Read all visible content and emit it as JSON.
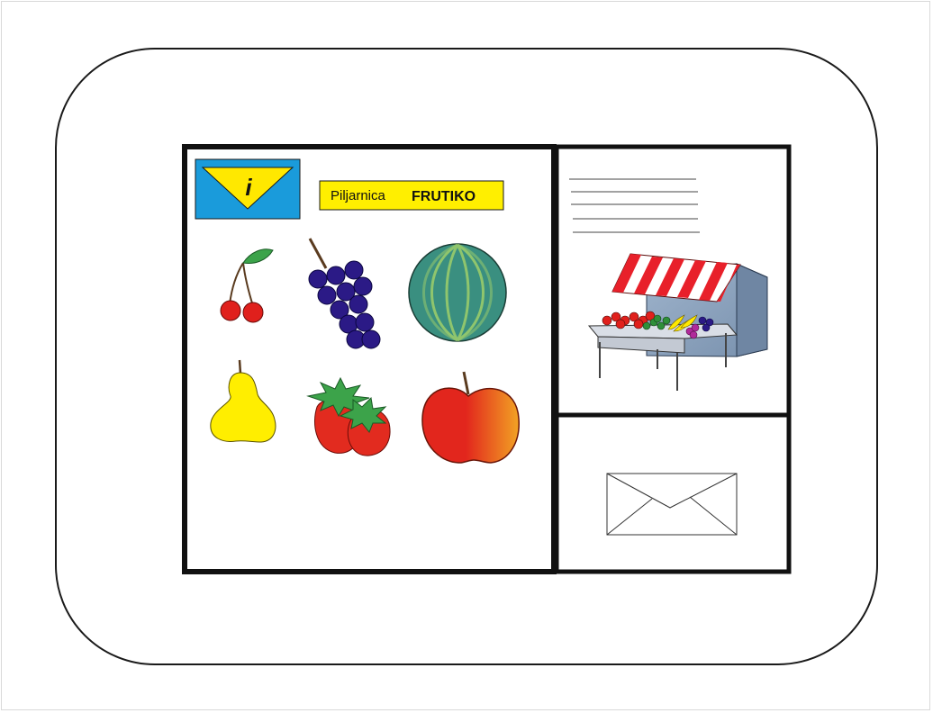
{
  "sign": {
    "info_symbol": "i",
    "shop_word": "Piljarnica",
    "shop_name": "FRUTIKO"
  },
  "fruits": [
    {
      "name": "cherries-icon"
    },
    {
      "name": "grapes-icon"
    },
    {
      "name": "watermelon-icon"
    },
    {
      "name": "pear-icon"
    },
    {
      "name": "strawberries-icon"
    },
    {
      "name": "apple-icon"
    }
  ],
  "colors": {
    "info_sign_bg": "#1a9bdb",
    "info_sign_triangle": "#ffe800",
    "shop_label_bg": "#ffef00",
    "frame": "#111111",
    "awning_red": "#e8202a",
    "cherry": "#e0201c",
    "grape": "#2b1a86",
    "watermelon": "#3a8f80",
    "pear": "#ffee00",
    "strawberry": "#e22b1f",
    "apple_red": "#e2261d",
    "apple_orange": "#f0a020",
    "leaf": "#3ca34a",
    "stall_wall": "#8ea5bf"
  }
}
